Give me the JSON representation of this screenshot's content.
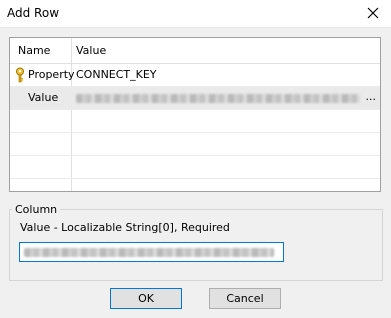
{
  "window": {
    "title": "Add Row"
  },
  "grid": {
    "columns": [
      "Name",
      "Value"
    ],
    "rows": [
      {
        "name": "Property",
        "value": "CONNECT_KEY",
        "icon": "key-icon"
      },
      {
        "name": "Value",
        "value": "",
        "value_suffix": "...",
        "selected": true
      }
    ]
  },
  "column_group": {
    "label": "Column",
    "description": "Value - Localizable String[0], Required",
    "input_value": ""
  },
  "buttons": {
    "ok": "OK",
    "cancel": "Cancel"
  },
  "colors": {
    "focus_border": "#0078d7",
    "selected_row": "#eaeaea"
  }
}
